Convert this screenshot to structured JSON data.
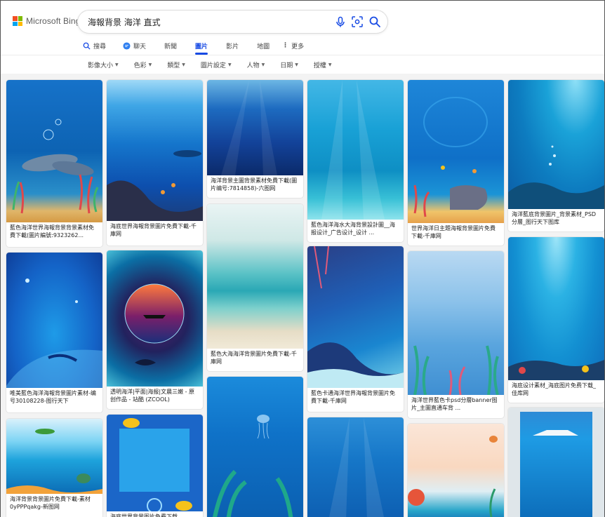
{
  "brand": {
    "logo_text": "Microsoft Bing",
    "colors": [
      "#f25022",
      "#7fba00",
      "#00a4ef",
      "#ffb900"
    ]
  },
  "search": {
    "query": "海報背景 海洋 直式",
    "icons": [
      "microphone-icon",
      "visual-search-icon",
      "search-icon"
    ]
  },
  "tabs": [
    {
      "label": "搜尋",
      "icon": "search-icon"
    },
    {
      "label": "聊天",
      "icon": "copilot-icon"
    },
    {
      "label": "新聞"
    },
    {
      "label": "圖片",
      "active": true
    },
    {
      "label": "影片"
    },
    {
      "label": "地圖"
    },
    {
      "label": "更多",
      "icon": "more-vertical-icon"
    }
  ],
  "filters": [
    "影像大小",
    "色彩",
    "類型",
    "圖片設定",
    "人物",
    "日期",
    "授權"
  ],
  "accent_color": "#174ae4",
  "results": [
    {
      "caption": "藍色海洋世界海報背景背景素材免費下載(圖片編號:9323262..."
    },
    {
      "caption": "海底世界海報背景圖片免費下載-千庫网"
    },
    {
      "caption": "海洋背景主圖背景素材免費下載(圖片编号:7814858)-六图网"
    },
    {
      "caption": "藍色海洋海水大海背景設計圖__海报设计_广告设计_设计 ..."
    },
    {
      "caption": "世界海洋日主題海報背景圖片免費下載-千庫网"
    },
    {
      "caption": "海洋藍底背景圖片_背景素材_PSD分層_图行天下图库"
    },
    {
      "caption": "唯美藍色海洋海報背景圖片素材-编号30108228-图行天下"
    },
    {
      "caption": "透明海洋|平面|海报|文晨三嫩 - 原创作品 - 站酷 (ZCOOL)"
    },
    {
      "caption": "藍色大海海洋背景圖片免費下載-千庫网"
    },
    {
      "caption": "藍色卡通海洋世界海報背景圖片免費下載-千庫网"
    },
    {
      "caption": "海洋世界藍色卡psd分層banner图片_主圖直通车背 ..."
    },
    {
      "caption": "海底设计素材_海底图片免费下载_佳库网"
    },
    {
      "caption": "海洋背景背景圖片免費下載-素材0yPPPqakg-新图网"
    },
    {
      "caption": "海底世界背景图片免费下载 ..."
    },
    {
      "caption": ""
    },
    {
      "caption": ""
    },
    {
      "caption": ""
    },
    {
      "caption": ""
    }
  ]
}
